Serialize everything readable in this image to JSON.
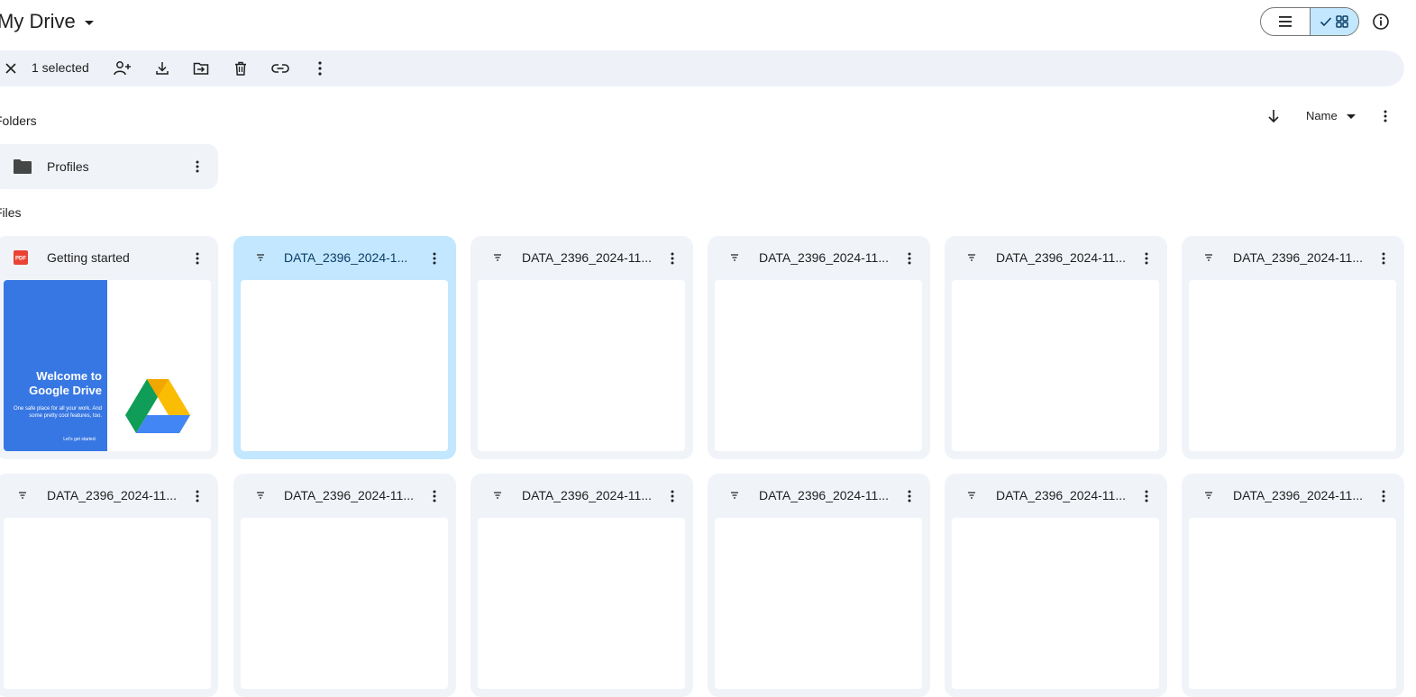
{
  "header": {
    "title": "My Drive",
    "view_modes": [
      "list",
      "grid"
    ],
    "active_view": "grid"
  },
  "selection_bar": {
    "count_label": "1 selected",
    "actions": [
      "share",
      "download",
      "move",
      "delete",
      "copy-link",
      "more"
    ]
  },
  "sort": {
    "label": "Name",
    "direction": "descending"
  },
  "sections": {
    "folders": "Folders",
    "files": "Files"
  },
  "folders": [
    {
      "name": "Profiles",
      "icon": "folder-icon"
    }
  ],
  "files": [
    {
      "name": "Getting started",
      "type": "pdf",
      "selected": false
    },
    {
      "name": "DATA_2396_2024-1...",
      "type": "filter",
      "selected": true
    },
    {
      "name": "DATA_2396_2024-11...",
      "type": "filter",
      "selected": false
    },
    {
      "name": "DATA_2396_2024-11...",
      "type": "filter",
      "selected": false
    },
    {
      "name": "DATA_2396_2024-11...",
      "type": "filter",
      "selected": false
    },
    {
      "name": "DATA_2396_2024-11...",
      "type": "filter",
      "selected": false
    },
    {
      "name": "DATA_2396_2024-11...",
      "type": "filter",
      "selected": false
    },
    {
      "name": "DATA_2396_2024-11...",
      "type": "filter",
      "selected": false
    },
    {
      "name": "DATA_2396_2024-11...",
      "type": "filter",
      "selected": false
    },
    {
      "name": "DATA_2396_2024-11...",
      "type": "filter",
      "selected": false
    },
    {
      "name": "DATA_2396_2024-11...",
      "type": "filter",
      "selected": false
    },
    {
      "name": "DATA_2396_2024-11...",
      "type": "filter",
      "selected": false
    }
  ],
  "welcome_thumbnail": {
    "title_line1": "Welcome to",
    "title_line2": "Google Drive",
    "subtitle": "One safe place for all your work. And some pretty cool features, too.",
    "cta": "Let's get started."
  },
  "pdf_badge": "PDF",
  "colors": {
    "selected_bg": "#c2e7ff",
    "card_bg": "#f0f4f9",
    "bar_bg": "#eef2f8",
    "pdf_red": "#ea4335",
    "welcome_blue": "#3777e3"
  }
}
